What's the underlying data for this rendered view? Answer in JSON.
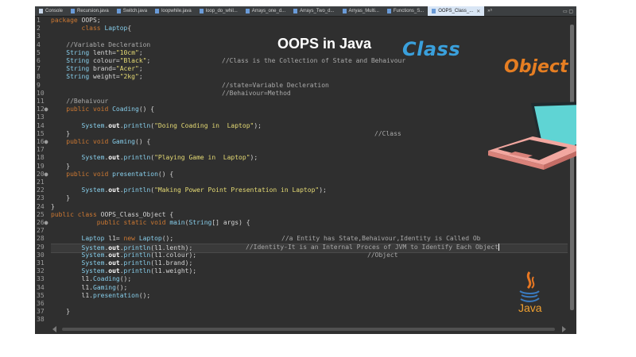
{
  "tabs": [
    {
      "label": "Console",
      "icon": "console-icon"
    },
    {
      "label": "Recursion.java",
      "icon": "java-file-icon"
    },
    {
      "label": "Switch.java",
      "icon": "java-file-icon"
    },
    {
      "label": "loopwhile.java",
      "icon": "java-file-icon"
    },
    {
      "label": "loop_do_whil...",
      "icon": "java-file-icon"
    },
    {
      "label": "Arrays_one_d...",
      "icon": "java-file-icon"
    },
    {
      "label": "Arrays_Two_d...",
      "icon": "java-file-icon"
    },
    {
      "label": "Arryas_Multi...",
      "icon": "java-file-icon"
    },
    {
      "label": "Functions_S...",
      "icon": "java-file-icon"
    },
    {
      "label": "OOPS_Class_...",
      "icon": "java-file-icon",
      "active": true
    }
  ],
  "tab_overflow": "»⁵",
  "window_controls": "▭ ▢",
  "overlay": {
    "title": "OOPS in Java",
    "class_label": "Class",
    "object_label": "Object",
    "java_label": "Java"
  },
  "editor": {
    "line_numbers": [
      "1",
      "2",
      "3",
      "4",
      "5",
      "6",
      "7",
      "8",
      "9",
      "10",
      "11",
      "12●",
      "13",
      "14",
      "15",
      "16●",
      "17",
      "18",
      "19",
      "20●",
      "21",
      "22",
      "23",
      "24",
      "25",
      "26●",
      "27",
      "28",
      "29",
      "30",
      "31",
      "32",
      "33",
      "34",
      "35",
      "36",
      "37",
      "38"
    ],
    "lines": [
      "package OOPS;",
      "        class Laptop{",
      "",
      "    //Variable Decleration",
      "    String lenth=\"10cm\";",
      "    String colour=\"Black\";",
      "    String brand=\"Acer\";",
      "    String weight=\"2kg\";",
      "",
      "",
      "    //Behaivour",
      "    public void Coading() {",
      "",
      "        System.out.println(\"Doing Coading in  Laptop\");",
      "    }",
      "    public void Gaming() {",
      "",
      "        System.out.println(\"Playing Game in  Laptop\");",
      "    }",
      "    public void presentation() {",
      "",
      "        System.out.println(\"Making Power Point Presentation in Laptop\");",
      "    }",
      "}",
      "public class OOPS_Class_Object {",
      "            public static void main(String[] args) {",
      "",
      "        Laptop l1= new Laptop();",
      "        System.out.println(l1.lenth);",
      "        System.out.println(l1.colour);",
      "        System.out.println(l1.brand);",
      "        System.out.println(l1.weight);",
      "        l1.Coading();",
      "        l1.Gaming();",
      "        l1.presentation();",
      "",
      "    }",
      ""
    ],
    "comments": {
      "c6": "//Class is the Collection of State and Behaivour",
      "c9": "//state=Variable Decleration",
      "c10": "//Behaivour=Method",
      "c15": "//Class",
      "c28": "//a Entity has State,Behaivour,Identity is Called Ob",
      "c29": "//Identity-It is an Internal Proces of JVM to Identify Each Object",
      "c30": "//Object"
    }
  },
  "colors": {
    "editor_bg": "#2f2f2f",
    "keyword": "#cc7832",
    "string": "#e6db74",
    "method": "#87ceeb",
    "class_accent": "#3aa0dc",
    "object_accent": "#e67e22",
    "laptop_screen": "#5fd4d4",
    "laptop_body": "#f2a7a0"
  }
}
